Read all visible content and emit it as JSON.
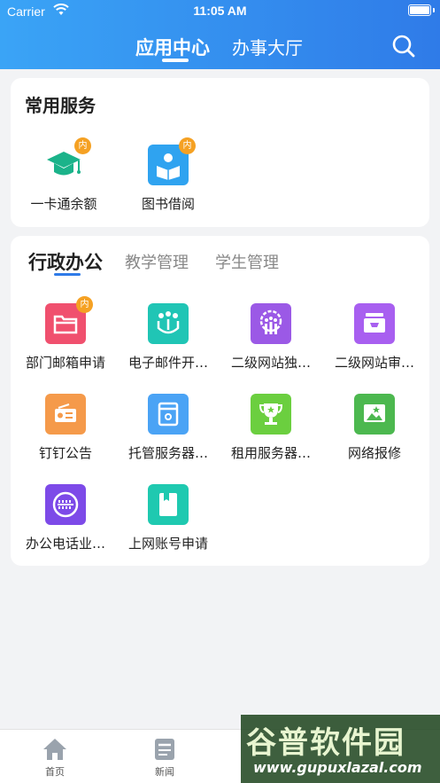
{
  "status_bar": {
    "carrier": "Carrier",
    "time": "11:05 AM"
  },
  "header": {
    "tabs": [
      {
        "label": "应用中心",
        "active": true
      },
      {
        "label": "办事大厅",
        "active": false
      }
    ],
    "search_icon": "search-icon",
    "gradient": [
      "#3aa4f6",
      "#2f7be8"
    ]
  },
  "common_services": {
    "title": "常用服务",
    "items": [
      {
        "label": "一卡通余额",
        "icon": "graduation-cap-icon",
        "badge": "内",
        "color": "#1bb38a"
      },
      {
        "label": "图书借阅",
        "icon": "book-reader-icon",
        "badge": "内",
        "color": "#2fa3f0"
      }
    ]
  },
  "office": {
    "tabs": [
      {
        "label": "行政办公",
        "active": true
      },
      {
        "label": "教学管理",
        "active": false
      },
      {
        "label": "学生管理",
        "active": false
      }
    ],
    "items": [
      {
        "label": "部门邮箱申请",
        "icon": "folder-icon",
        "badge": "内",
        "color": "#f0506e"
      },
      {
        "label": "电子邮件开…",
        "icon": "people-icon",
        "badge": "",
        "color": "#20c5b5"
      },
      {
        "label": "二级网站独…",
        "icon": "gear-people-icon",
        "badge": "",
        "color": "#9b59e6"
      },
      {
        "label": "二级网站审…",
        "icon": "inbox-icon",
        "badge": "",
        "color": "#a85ff0"
      },
      {
        "label": "钉钉公告",
        "icon": "radio-icon",
        "badge": "",
        "color": "#f59a4a"
      },
      {
        "label": "托管服务器…",
        "icon": "server-icon",
        "badge": "",
        "color": "#4aa3f5"
      },
      {
        "label": "租用服务器…",
        "icon": "trophy-icon",
        "badge": "",
        "color": "#6bcf3f"
      },
      {
        "label": "网络报修",
        "icon": "repair-icon",
        "badge": "",
        "color": "#4cb84f"
      },
      {
        "label": "办公电话业…",
        "icon": "phone-icon",
        "badge": "",
        "color": "#7d4ae8"
      },
      {
        "label": "上网账号申请",
        "icon": "account-book-icon",
        "badge": "",
        "color": "#1fc9b0"
      }
    ]
  },
  "tabbar": {
    "items": [
      {
        "label": "首页",
        "icon": "home-icon"
      },
      {
        "label": "新闻",
        "icon": "news-icon"
      }
    ]
  },
  "watermark": {
    "main": "谷普软件园",
    "sub": "www.gupuxlazal.com"
  }
}
